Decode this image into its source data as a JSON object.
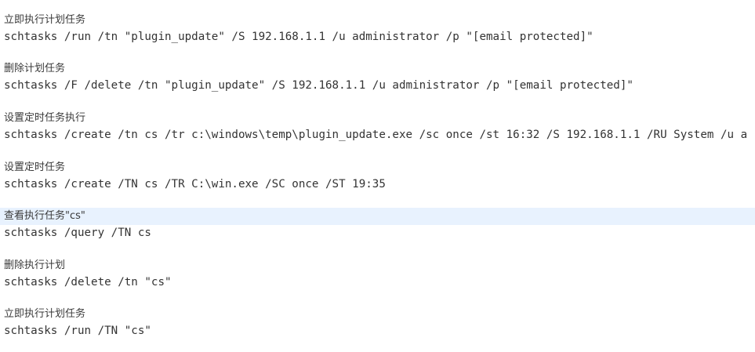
{
  "code_block": {
    "lines": [
      {
        "kind": "comment",
        "text": "立即执行计划任务"
      },
      {
        "kind": "command",
        "text": "schtasks /run /tn \"plugin_update\" /S 192.168.1.1 /u administrator /p \"[email protected]\""
      },
      {
        "kind": "comment",
        "text": "删除计划任务"
      },
      {
        "kind": "command",
        "text": "schtasks /F /delete /tn \"plugin_update\" /S 192.168.1.1 /u administrator /p \"[email protected]\""
      },
      {
        "kind": "comment",
        "text": "设置定时任务执行"
      },
      {
        "kind": "command",
        "text": "schtasks /create /tn cs /tr c:\\windows\\temp\\plugin_update.exe /sc once /st 16:32 /S 192.168.1.1 /RU System /u a"
      },
      {
        "kind": "comment",
        "text": "设置定时任务"
      },
      {
        "kind": "command",
        "text": "schtasks /create /TN cs /TR C:\\win.exe /SC once /ST 19:35"
      },
      {
        "kind": "comment",
        "text": "查看执行任务\"cs\"",
        "highlighted": true
      },
      {
        "kind": "command",
        "text": "schtasks /query /TN cs"
      },
      {
        "kind": "comment",
        "text": "删除执行计划"
      },
      {
        "kind": "command",
        "text": "schtasks /delete /tn \"cs\""
      },
      {
        "kind": "comment",
        "text": "立即执行计划任务"
      },
      {
        "kind": "command",
        "text": "schtasks /run /TN \"cs\""
      }
    ]
  }
}
